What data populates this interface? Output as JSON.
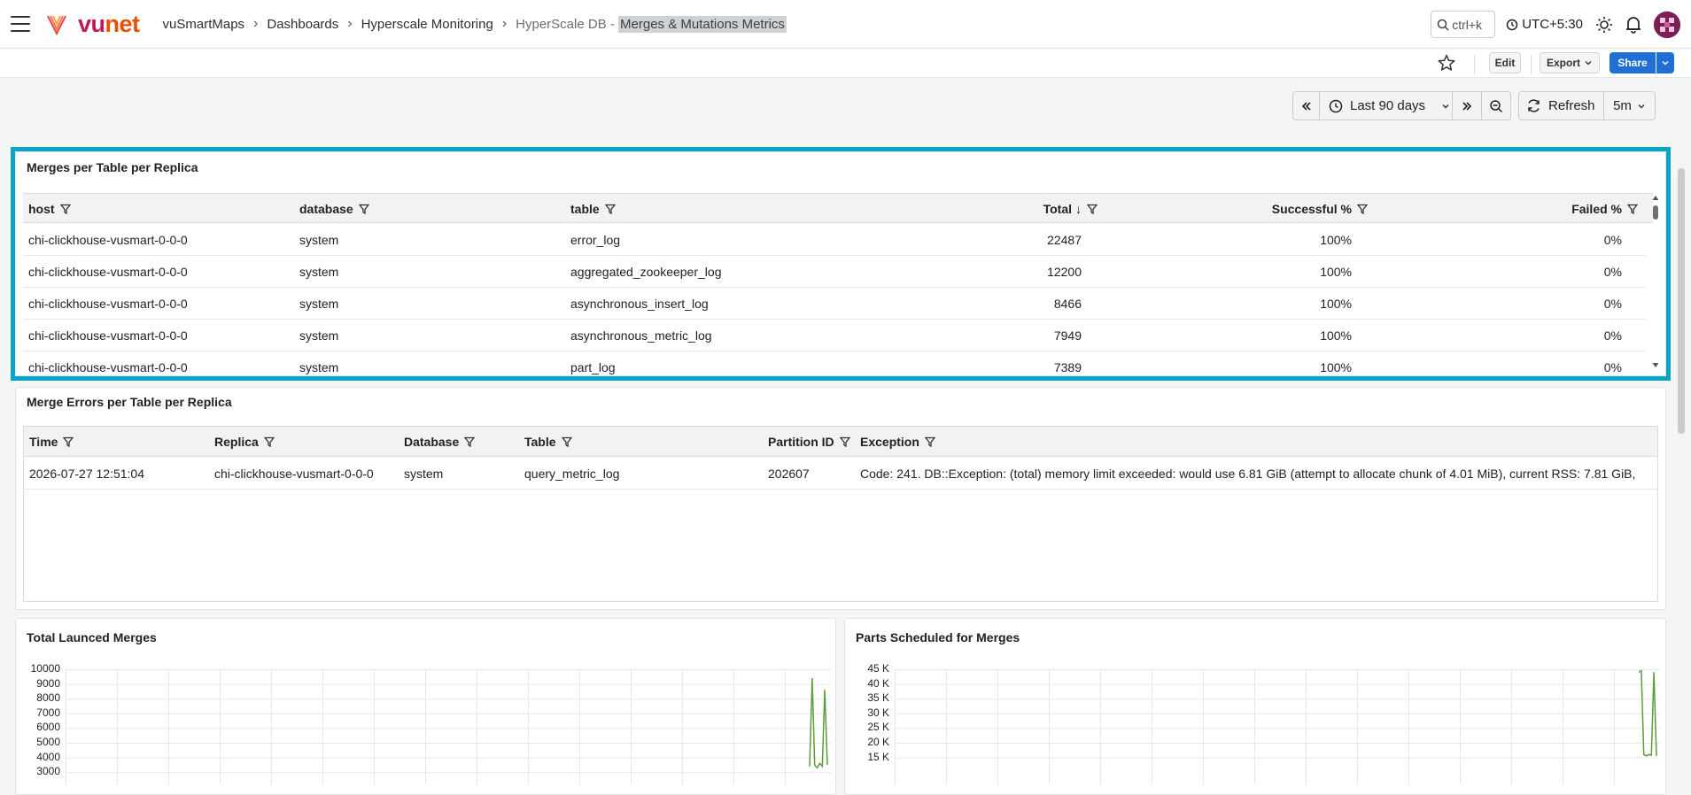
{
  "header": {
    "logo_text_a": "vu",
    "logo_text_b": "net",
    "breadcrumb": [
      "vuSmartMaps",
      "Dashboards",
      "Hyperscale Monitoring"
    ],
    "current_prefix": "HyperScale DB - ",
    "current_highlight": "Merges & Mutations Metrics",
    "search_hint": "ctrl+k",
    "timezone": "UTC+5:30"
  },
  "toolbar": {
    "edit_label": "Edit",
    "export_label": "Export",
    "share_label": "Share"
  },
  "timepicker": {
    "range_label": "Last 90 days",
    "refresh_label": "Refresh",
    "interval_label": "5m"
  },
  "merges_panel": {
    "title": "Merges per Table per Replica",
    "columns": [
      "host",
      "database",
      "table",
      "Total",
      "Successful %",
      "Failed %"
    ],
    "sort_indicator": "↓",
    "rows": [
      [
        "chi-clickhouse-vusmart-0-0-0",
        "system",
        "error_log",
        "22487",
        "100%",
        "0%"
      ],
      [
        "chi-clickhouse-vusmart-0-0-0",
        "system",
        "aggregated_zookeeper_log",
        "12200",
        "100%",
        "0%"
      ],
      [
        "chi-clickhouse-vusmart-0-0-0",
        "system",
        "asynchronous_insert_log",
        "8466",
        "100%",
        "0%"
      ],
      [
        "chi-clickhouse-vusmart-0-0-0",
        "system",
        "asynchronous_metric_log",
        "7949",
        "100%",
        "0%"
      ],
      [
        "chi-clickhouse-vusmart-0-0-0",
        "system",
        "part_log",
        "7389",
        "100%",
        "0%"
      ]
    ]
  },
  "errors_panel": {
    "title": "Merge Errors per Table per Replica",
    "columns": [
      "Time",
      "Replica",
      "Database",
      "Table",
      "Partition ID",
      "Exception"
    ],
    "rows": [
      [
        "2026-07-27 12:51:04",
        "chi-clickhouse-vusmart-0-0-0",
        "system",
        "query_metric_log",
        "202607",
        "Code: 241. DB::Exception: (total) memory limit exceeded: would use 6.81 GiB (attempt to allocate chunk of 4.01 MiB), current RSS: 7.81 GiB,"
      ]
    ]
  },
  "launched_panel": {
    "title": "Total Launced Merges",
    "y_ticks": [
      "10000",
      "9000",
      "8000",
      "7000",
      "6000",
      "5000",
      "4000",
      "3000"
    ]
  },
  "scheduled_panel": {
    "title": "Parts Scheduled for Merges",
    "y_ticks": [
      "45 K",
      "40 K",
      "35 K",
      "30 K",
      "25 K",
      "20 K",
      "15 K"
    ]
  },
  "chart_data": [
    {
      "type": "line",
      "title": "Total Launced Merges",
      "ylim": [
        3000,
        10000
      ],
      "series": [
        {
          "values": [
            3400,
            9400,
            3500,
            3300,
            3600,
            3400,
            8600,
            3500
          ]
        }
      ],
      "color": "#5a9e3a"
    },
    {
      "type": "line",
      "title": "Parts Scheduled for Merges",
      "ylim": [
        15000,
        45000
      ],
      "series": [
        {
          "values": [
            44000,
            44500,
            16000,
            15500,
            16000,
            15800,
            44000,
            15500
          ]
        }
      ],
      "color": "#5a9e3a"
    }
  ]
}
